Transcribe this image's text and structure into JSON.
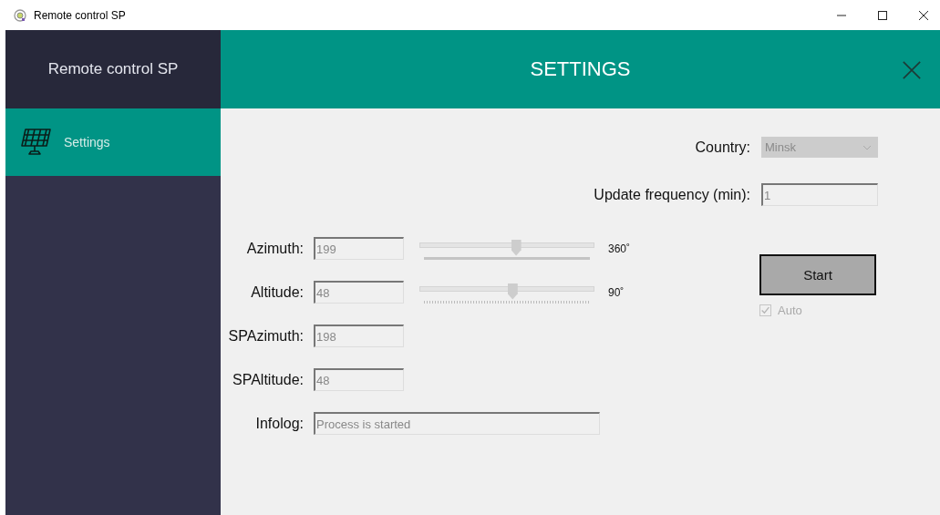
{
  "window": {
    "title": "Remote control SP"
  },
  "sidebar": {
    "title": "Remote control SP",
    "items": [
      {
        "label": "Settings",
        "selected": true
      }
    ]
  },
  "header": {
    "title": "SETTINGS"
  },
  "country": {
    "label": "Country:",
    "value": "Minsk",
    "disabled": true
  },
  "update_frequency": {
    "label": "Update frequency (min):",
    "value": "1"
  },
  "fields": [
    {
      "label": "Azimuth:",
      "value": "199",
      "slider": {
        "level": 0.55,
        "max_label": "360˚",
        "ticks": false
      }
    },
    {
      "label": "Altitude:",
      "value": "48",
      "slider": {
        "level": 0.53,
        "max_label": "90˚",
        "ticks": true
      }
    },
    {
      "label": "SPAzimuth:",
      "value": "198"
    },
    {
      "label": "SPAltitude:",
      "value": "48"
    },
    {
      "label": "Infolog:",
      "value": "Process is started",
      "wide": true
    }
  ],
  "start_button": {
    "label": "Start"
  },
  "auto": {
    "label": "Auto",
    "checked": true,
    "disabled": true
  }
}
